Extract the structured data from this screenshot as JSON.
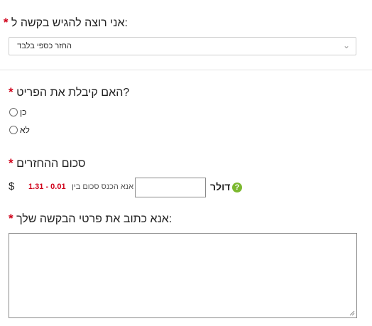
{
  "q1": {
    "label": "אני רוצה להגיש בקשה ל:",
    "required_mark": "*",
    "select_value": "החזר כספי בלבד",
    "chevron_icon": "chevron-down-icon"
  },
  "q2": {
    "label": "האם קיבלת את הפריט?",
    "required_mark": "*",
    "options": [
      "כן",
      "לא"
    ]
  },
  "q3": {
    "label": "סכום ההחזרים",
    "required_mark": "*",
    "currency": "$",
    "range_hint": "אנא הכנס סכום בין",
    "range_values": "1.31 - 0.01",
    "unit": "דולר",
    "help_icon": "?"
  },
  "q4": {
    "label": "אנא כתוב את פרטי הבקשה שלך:",
    "required_mark": "*"
  },
  "colors": {
    "required": "#d0021b",
    "range": "#d0021b",
    "help": "#7cb82f"
  }
}
